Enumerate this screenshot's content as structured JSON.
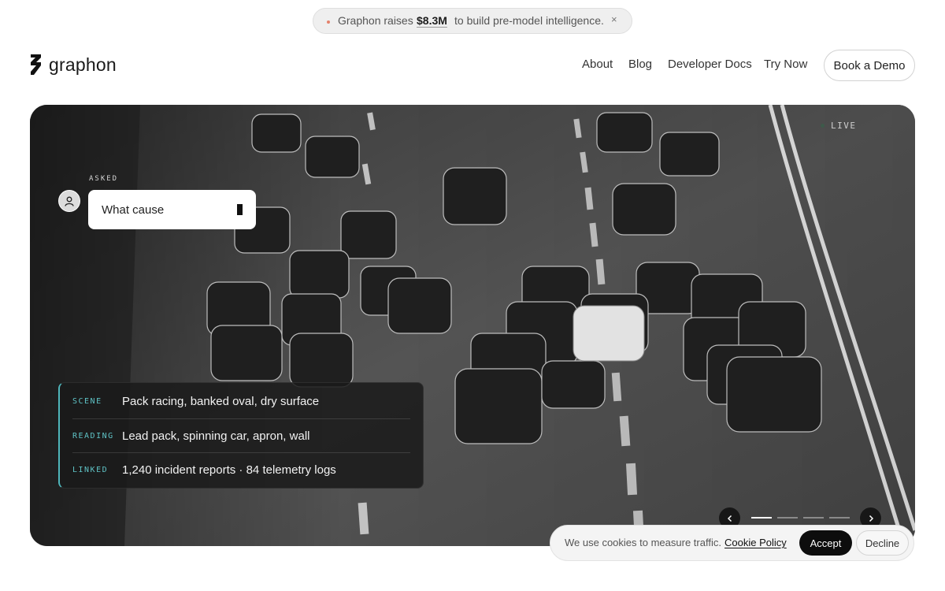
{
  "announcement": {
    "prefix": "Graphon raises",
    "amount": "$8.3M",
    "suffix": "to build pre-model intelligence.",
    "close_glyph": "×",
    "dot_color": "#e4826c"
  },
  "header": {
    "brand": "graphon",
    "logo_icon": "graphon-logo-icon",
    "nav": [
      "About",
      "Blog",
      "Developer Docs",
      "Try Now"
    ],
    "cta": "Book a Demo"
  },
  "hero": {
    "status": "LIVE",
    "asked_label": "ASKED",
    "query_text": "What cause",
    "avatar_icon": "user-icon",
    "accent_color": "#5fc3c6",
    "info_rows": [
      {
        "key": "SCENE",
        "value": "Pack racing, banked oval, dry surface"
      },
      {
        "key": "READING",
        "value": "Lead pack, spinning car, apron, wall"
      },
      {
        "key": "LINKED",
        "value": "1,240 incident reports · 84 telemetry logs"
      }
    ],
    "carousel": {
      "prev_icon": "chevron-left-icon",
      "next_icon": "chevron-right-icon",
      "slide_count": 4,
      "active_index": 0
    }
  },
  "cookie": {
    "message": "We use cookies to measure traffic.",
    "policy_link": "Cookie Policy",
    "accept": "Accept",
    "decline": "Decline"
  }
}
